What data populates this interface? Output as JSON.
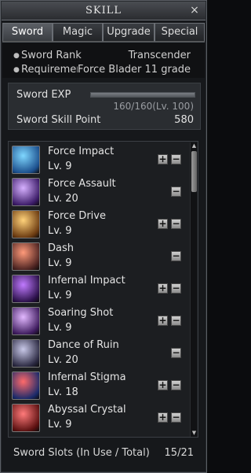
{
  "window": {
    "title": "SKILL",
    "close": "×"
  },
  "tabs": [
    {
      "label": "Sword",
      "active": true
    },
    {
      "label": "Magic",
      "active": false
    },
    {
      "label": "Upgrade",
      "active": false
    },
    {
      "label": "Special",
      "active": false
    }
  ],
  "info": {
    "rank_label": "Sword Rank",
    "rank_value": "Transcender",
    "req_label": "Requiremen",
    "req_value": "Force Blader 11 grade"
  },
  "exp": {
    "label": "Sword EXP",
    "value": "160/160(Lv. 100)",
    "progress": 1.0,
    "skill_point_label": "Sword Skill Point",
    "skill_point_value": "580"
  },
  "skills": [
    {
      "name": "Force Impact",
      "level": "Lv. 9",
      "plus": "+",
      "minus": "−",
      "has_plus": true,
      "icon": "force-impact-icon",
      "c1": "#7fd7ff",
      "c2": "#1b4e8c"
    },
    {
      "name": "Force Assault",
      "level": "Lv. 20",
      "plus": "+",
      "minus": "−",
      "has_plus": false,
      "icon": "force-assault-icon",
      "c1": "#d6b0ff",
      "c2": "#3a1a66"
    },
    {
      "name": "Force Drive",
      "level": "Lv. 9",
      "plus": "+",
      "minus": "−",
      "has_plus": true,
      "icon": "force-drive-icon",
      "c1": "#ffd27a",
      "c2": "#6b3a10"
    },
    {
      "name": "Dash",
      "level": "Lv. 9",
      "plus": "+",
      "minus": "−",
      "has_plus": false,
      "icon": "dash-icon",
      "c1": "#ff9a7a",
      "c2": "#4a2220"
    },
    {
      "name": "Infernal Impact",
      "level": "Lv. 9",
      "plus": "+",
      "minus": "−",
      "has_plus": true,
      "icon": "infernal-impact-icon",
      "c1": "#c07aff",
      "c2": "#2a1048"
    },
    {
      "name": "Soaring Shot",
      "level": "Lv. 9",
      "plus": "+",
      "minus": "−",
      "has_plus": true,
      "icon": "soaring-shot-icon",
      "c1": "#e2b8ff",
      "c2": "#3c1a5c"
    },
    {
      "name": "Dance of Ruin",
      "level": "Lv. 20",
      "plus": "+",
      "minus": "−",
      "has_plus": false,
      "icon": "dance-of-ruin-icon",
      "c1": "#c8c8e8",
      "c2": "#2a2840"
    },
    {
      "name": "Infernal Stigma",
      "level": "Lv. 18",
      "plus": "+",
      "minus": "−",
      "has_plus": true,
      "icon": "infernal-stigma-icon",
      "c1": "#ff6a6a",
      "c2": "#1a2a6a"
    },
    {
      "name": "Abyssal Crystal",
      "level": "Lv. 9",
      "plus": "+",
      "minus": "−",
      "has_plus": true,
      "icon": "abyssal-crystal-icon",
      "c1": "#ff7a7a",
      "c2": "#5a1010"
    }
  ],
  "scrollbar": {
    "up": "▲",
    "down": "▼"
  },
  "footer": {
    "label": "Sword Slots (In Use / Total)",
    "value": "15/21"
  }
}
